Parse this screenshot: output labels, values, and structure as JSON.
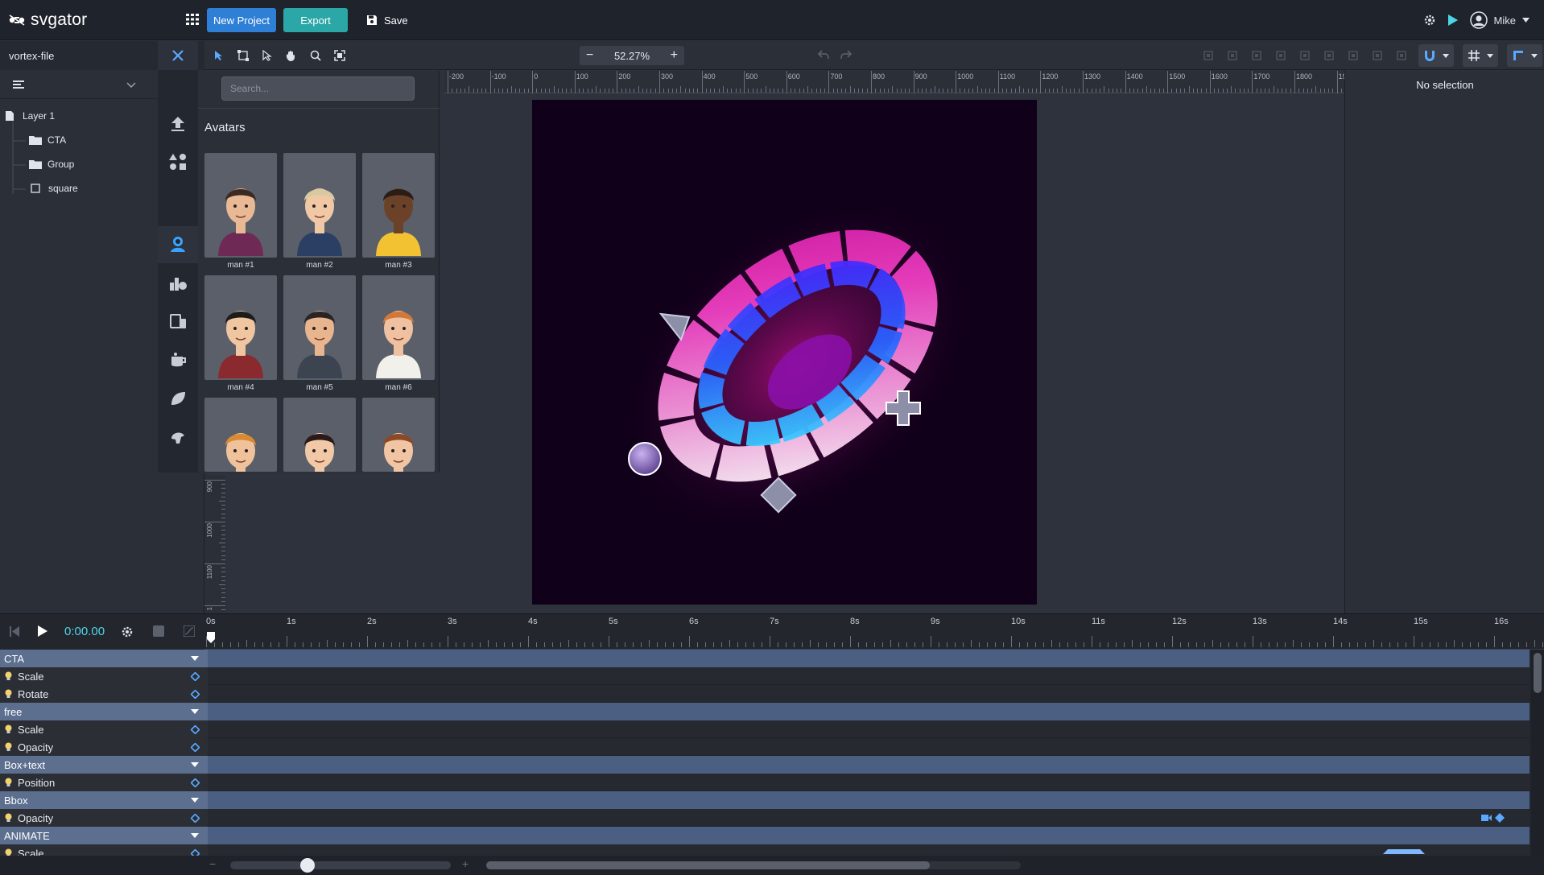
{
  "header": {
    "brand": "svgator",
    "new_project_label": "New Project",
    "export_label": "Export",
    "save_label": "Save",
    "user_name": "Mike"
  },
  "file": {
    "name": "vortex-file"
  },
  "layers": [
    {
      "label": "Layer 1",
      "icon": "page-icon"
    },
    {
      "label": "CTA",
      "icon": "folder-icon"
    },
    {
      "label": "Group",
      "icon": "folder-icon"
    },
    {
      "label": "square",
      "icon": "square-icon"
    }
  ],
  "assets": {
    "search_placeholder": "Search...",
    "category": "Avatars",
    "items": [
      {
        "label": "man #1",
        "shirt": "#6e2a55",
        "skin": "#e9b995",
        "hair": "#3a2a22"
      },
      {
        "label": "man #2",
        "shirt": "#2a3f63",
        "skin": "#f1c8a5",
        "hair": "#d8c9a0"
      },
      {
        "label": "man #3",
        "shirt": "#f3c232",
        "skin": "#6b4228",
        "hair": "#2a1d16"
      },
      {
        "label": "man #4",
        "shirt": "#8a2a2e",
        "skin": "#f0c6a1",
        "hair": "#1e1b1b"
      },
      {
        "label": "man #5",
        "shirt": "#3b4450",
        "skin": "#e8b58e",
        "hair": "#2a2524"
      },
      {
        "label": "man #6",
        "shirt": "#f2f0ea",
        "skin": "#f0c1a0",
        "hair": "#d2793a"
      },
      {
        "label": "",
        "shirt": "#8ac13b",
        "skin": "#f0c29c",
        "hair": "#d98a32"
      },
      {
        "label": "",
        "shirt": "#9b1e2e",
        "skin": "#f2c9a6",
        "hair": "#2a1a1a"
      },
      {
        "label": "",
        "shirt": "#2a3c7a",
        "skin": "#f1c5a3",
        "hair": "#8a4a28"
      }
    ]
  },
  "toolbar": {
    "zoom": "52.27%"
  },
  "rulers": {
    "h_ticks": [
      "-200",
      "-100",
      "0",
      "100",
      "200",
      "300",
      "400",
      "500",
      "600",
      "700",
      "800",
      "900",
      "1000",
      "1100",
      "1200",
      "1300",
      "1400",
      "1500",
      "1600",
      "1700",
      "1800",
      "19"
    ],
    "v_ticks": [
      "900",
      "1000",
      "1100",
      "1"
    ]
  },
  "inspector": {
    "status": "No selection"
  },
  "timeline": {
    "time": "0:00.00",
    "seconds": [
      "0s",
      "1s",
      "2s",
      "3s",
      "4s",
      "5s",
      "6s",
      "7s",
      "8s",
      "9s",
      "10s",
      "11s",
      "12s",
      "13s",
      "14s",
      "15s",
      "16s"
    ],
    "rows": [
      {
        "type": "group",
        "label": "CTA"
      },
      {
        "type": "prop",
        "label": "Scale"
      },
      {
        "type": "prop",
        "label": "Rotate"
      },
      {
        "type": "group",
        "label": "free"
      },
      {
        "type": "prop",
        "label": "Scale"
      },
      {
        "type": "prop",
        "label": "Opacity"
      },
      {
        "type": "group",
        "label": "Box+text"
      },
      {
        "type": "prop",
        "label": "Position"
      },
      {
        "type": "group",
        "label": "Bbox"
      },
      {
        "type": "prop",
        "label": "Opacity"
      },
      {
        "type": "group",
        "label": "ANIMATE"
      },
      {
        "type": "prop",
        "label": "Scale"
      }
    ],
    "zoom_level": 0.35,
    "scroll_start": 0.0,
    "scroll_end": 0.83
  },
  "colors": {
    "accent_blue": "#2e7fd6",
    "accent_teal": "#2aa7a6",
    "cyan": "#4fd6e6",
    "stage_bg": "#11001a"
  }
}
